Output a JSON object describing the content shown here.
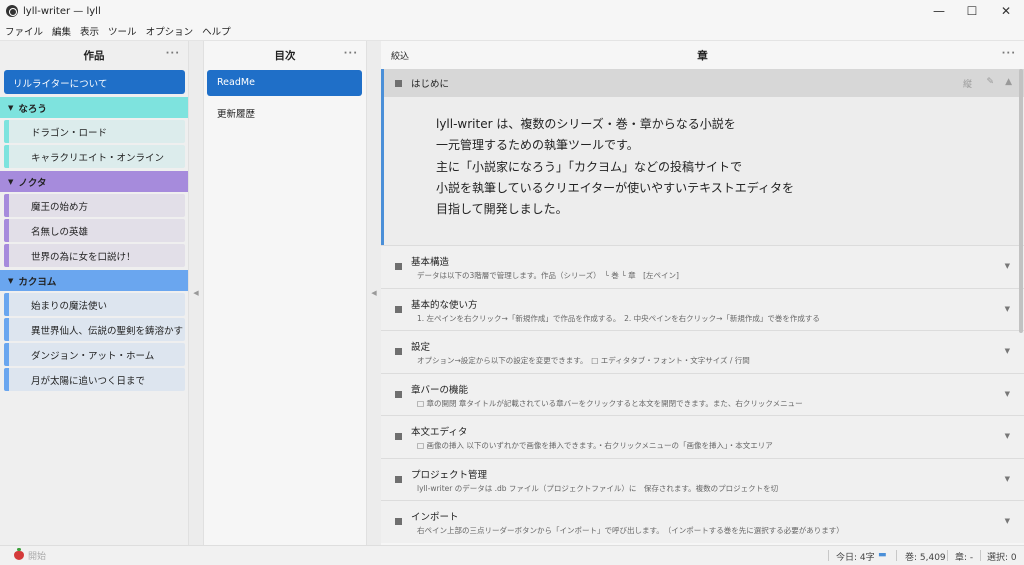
{
  "window": {
    "title": "lyll-writer — lyll",
    "controls": {
      "minimize": "—",
      "maximize": "☐",
      "close": "✕"
    }
  },
  "menu": [
    "ファイル",
    "編集",
    "表示",
    "ツール",
    "オプション",
    "ヘルプ"
  ],
  "left_pane": {
    "header": "作品",
    "more": "···",
    "about": "リルライターについて",
    "groups": [
      {
        "name": "なろう",
        "color": "#7ee3de",
        "item_bg": "#dcecec",
        "items": [
          "ドラゴン・ロード",
          "キャラクリエイト・オンライン"
        ]
      },
      {
        "name": "ノクタ",
        "color": "#a68bdc",
        "item_bg": "#e2dfe8",
        "items": [
          "魔王の始め方",
          "名無しの英雄",
          "世界の為に女を口説け！"
        ]
      },
      {
        "name": "カクヨム",
        "color": "#6aa6ef",
        "item_bg": "#dde5ef",
        "items": [
          "始まりの魔法使い",
          "異世界仙人、伝説の聖剣を鋳溶かす",
          "ダンジョン・アット・ホーム",
          "月が太陽に追いつく日まで"
        ]
      }
    ]
  },
  "mid_pane": {
    "header": "目次",
    "more": "···",
    "items": [
      "ReadMe",
      "更新履歴"
    ],
    "selected": 0
  },
  "right_pane": {
    "filter": "絞込",
    "header": "章",
    "more": "···",
    "active_chapter": {
      "title": "はじめに",
      "icons": {
        "vertical": "縦",
        "link": "✎",
        "collapse": "▲"
      },
      "body": [
        "lyll-writer は、複数のシリーズ・巻・章からなる小説を",
        "一元管理するための執筆ツールです。",
        "主に「小説家になろう」「カクヨム」などの投稿サイトで",
        "小説を執筆しているクリエイターが使いやすいテキストエディタを",
        "目指して開発しました。"
      ]
    },
    "chapters": [
      {
        "title": "基本構造",
        "summary": "データは以下の3階層で管理します。作品（シリーズ）　└ 巻 └ 章　[左ペイン]"
      },
      {
        "title": "基本的な使い方",
        "summary": "1. 左ペインを右クリック→「新規作成」で作品を作成する。　2. 中央ペインを右クリック→「新規作成」で巻を作成する"
      },
      {
        "title": "設定",
        "summary": "オプション→設定から以下の設定を変更できます。　□ エディタタブ・フォント・文字サイズ / 行間"
      },
      {
        "title": "章バーの機能",
        "summary": "□ 章の開閉 章タイトルが記載されている章バーをクリックすると本文を開閉できます。また、右クリックメニュー"
      },
      {
        "title": "本文エディタ",
        "summary": "□ 画像の挿入 以下のいずれかで画像を挿入できます。・右クリックメニューの「画像を挿入」・本文エリア"
      },
      {
        "title": "プロジェクト管理",
        "summary": "lyll-writer のデータは .db ファイル（プロジェクトファイル）に　保存されます。複数のプロジェクトを切"
      },
      {
        "title": "インポート",
        "summary": "右ペイン上部の三点リーダーボタンから「インポート」で呼び出します。　（インポートする巻を先に選択する必要があります）"
      }
    ],
    "chevron": "▼"
  },
  "status": {
    "left": "開始",
    "today": "今日: 4字",
    "volume": "巻: 5,409",
    "chapter": "章: -",
    "selection": "選択: 0"
  }
}
